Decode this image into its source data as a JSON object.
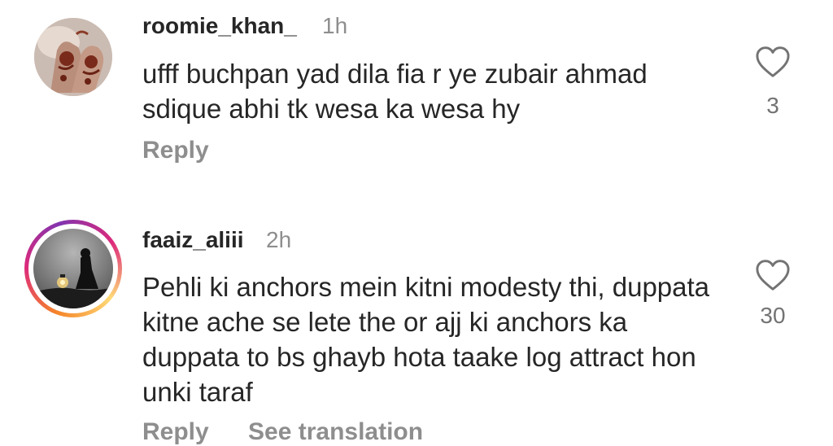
{
  "comments": [
    {
      "username": "roomie_khan_",
      "time": "1h",
      "text": "ufff buchpan yad dila fia r ye zubair ahmad sdique abhi tk wesa ka wesa hy",
      "reply_label": "Reply",
      "likes": "3",
      "avatar_icon": "henna-hands-avatar",
      "heart_icon": "heart-outline-icon"
    },
    {
      "username": "faaiz_aliii",
      "time": "2h",
      "text": "Pehli ki anchors mein kitni modesty thi, duppata kitne ache se lete the or ajj ki anchors ka duppata to bs ghayb hota taake log attract hon unki taraf",
      "reply_label": "Reply",
      "more_label": "See translation",
      "likes": "30",
      "avatar_icon": "silhouette-lantern-avatar",
      "heart_icon": "heart-outline-icon",
      "story_ring": true
    }
  ],
  "colors": {
    "username": "#262626",
    "secondary": "#8e8e8e",
    "story_ring_start": "#f58529",
    "story_ring_mid": "#dd2a7b",
    "story_ring_end": "#8134af"
  }
}
